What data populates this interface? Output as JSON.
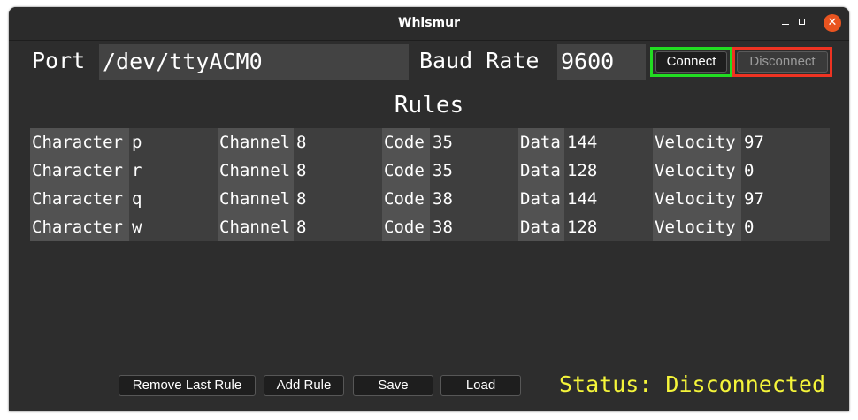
{
  "window": {
    "title": "Whismur"
  },
  "connection": {
    "port_label": "Port",
    "port_value": "/dev/ttyACM0",
    "baud_label": "Baud Rate",
    "baud_value": "9600",
    "connect_label": "Connect",
    "disconnect_label": "Disconnect",
    "connect_highlight_color": "#22dd22",
    "disconnect_highlight_color": "#ee3322"
  },
  "rules": {
    "title": "Rules",
    "labels": {
      "character": "Character",
      "channel": "Channel",
      "code": "Code",
      "data": "Data",
      "velocity": "Velocity"
    },
    "rows": [
      {
        "character": "p",
        "channel": "8",
        "code": "35",
        "data": "144",
        "velocity": "97"
      },
      {
        "character": "r",
        "channel": "8",
        "code": "35",
        "data": "128",
        "velocity": "0"
      },
      {
        "character": "q",
        "channel": "8",
        "code": "38",
        "data": "144",
        "velocity": "97"
      },
      {
        "character": "w",
        "channel": "8",
        "code": "38",
        "data": "128",
        "velocity": "0"
      }
    ]
  },
  "footer": {
    "remove_last_rule_label": "Remove Last Rule",
    "add_rule_label": "Add Rule",
    "save_label": "Save",
    "load_label": "Load",
    "status_text": "Status: Disconnected",
    "status_color": "#f4f43a"
  }
}
